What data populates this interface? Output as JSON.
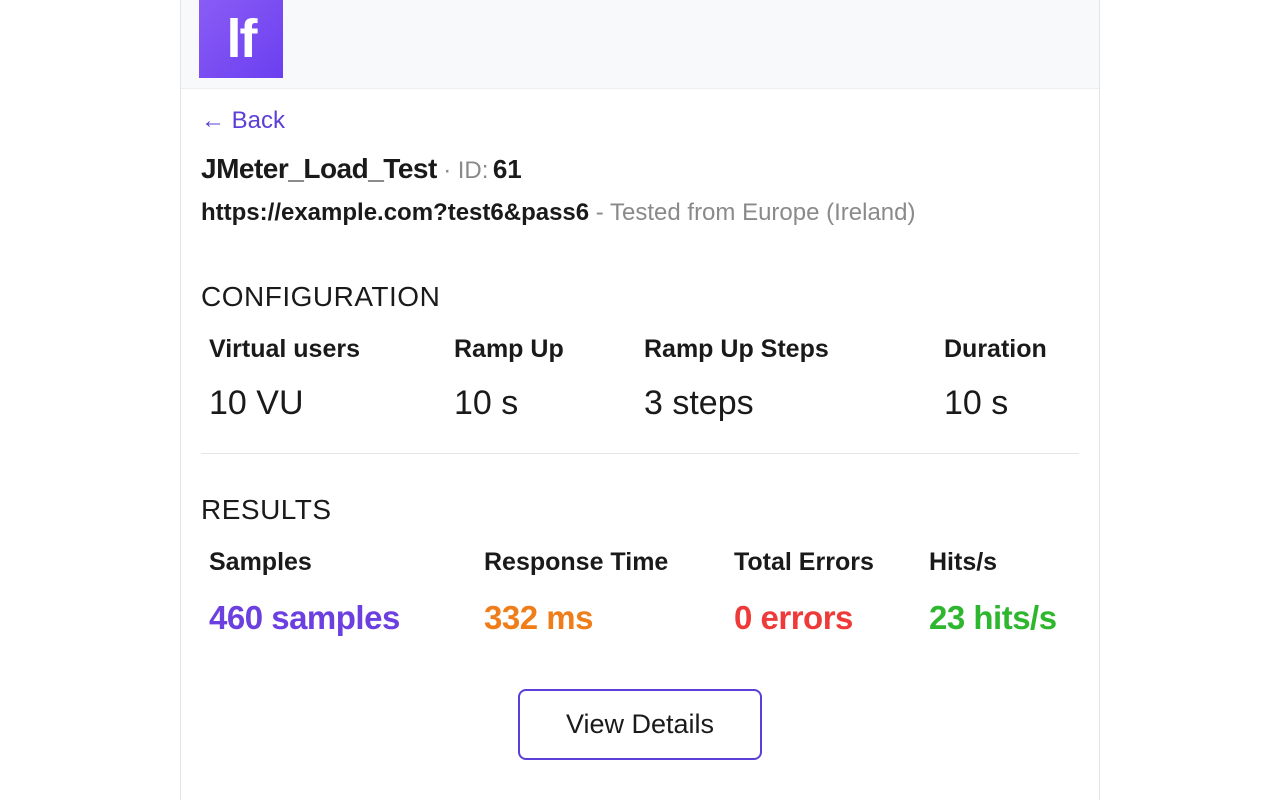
{
  "logo_text": "lf",
  "back_link": "← Back",
  "title": {
    "name": "JMeter_Load_Test",
    "separator": "·",
    "id_label": "ID:",
    "id_value": "61"
  },
  "url": {
    "value": "https://example.com?test6&pass6",
    "location": " - Tested from Europe (Ireland)"
  },
  "sections": {
    "configuration_heading": "CONFIGURATION",
    "results_heading": "RESULTS"
  },
  "config": {
    "virtual_users": {
      "label": "Virtual users",
      "value": "10 VU"
    },
    "ramp_up": {
      "label": "Ramp Up",
      "value": "10 s"
    },
    "ramp_up_steps": {
      "label": "Ramp Up Steps",
      "value": "3 steps"
    },
    "duration": {
      "label": "Duration",
      "value": "10 s"
    }
  },
  "results": {
    "samples": {
      "label": "Samples",
      "value": "460 samples"
    },
    "response_time": {
      "label": "Response Time",
      "value": "332 ms"
    },
    "total_errors": {
      "label": "Total Errors",
      "value": "0 errors"
    },
    "hits_per_sec": {
      "label": "Hits/s",
      "value": "23 hits/s"
    }
  },
  "buttons": {
    "view_details": "View Details"
  }
}
